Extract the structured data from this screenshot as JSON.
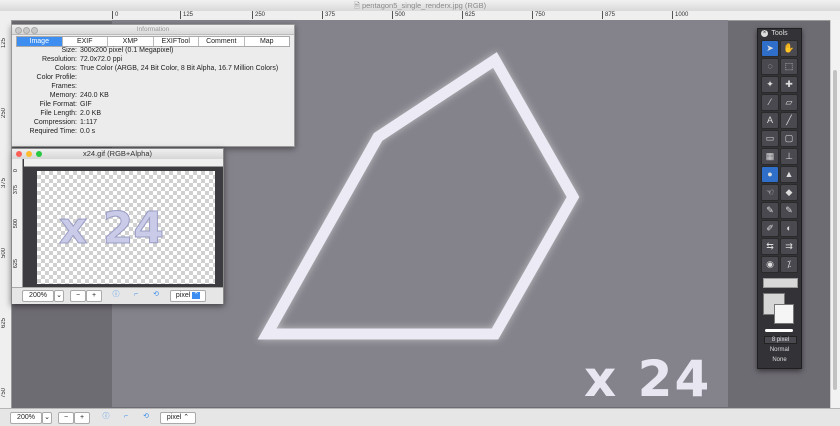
{
  "window": {
    "title": "pentagon5_single_renderx.jpg (RGB)"
  },
  "ruler_top": [
    "0",
    "125",
    "250",
    "375",
    "500",
    "625",
    "750",
    "875",
    "1000"
  ],
  "ruler_left": [
    "125",
    "250",
    "375",
    "500",
    "625",
    "750"
  ],
  "canvas": {
    "overlay_text": "x 24"
  },
  "bottom": {
    "zoom": "200%",
    "minus": "−",
    "plus": "+",
    "unit": "pixel"
  },
  "info": {
    "title": "Information",
    "tabs": [
      "Image",
      "EXIF",
      "XMP",
      "EXIFTool",
      "Comment",
      "Map"
    ],
    "rows": [
      {
        "k": "Size:",
        "v": "300x200 pixel (0.1 Megapixel)"
      },
      {
        "k": "Resolution:",
        "v": "72.0x72.0 ppi"
      },
      {
        "k": "Colors:",
        "v": "True Color (ARGB, 24 Bit Color, 8 Bit Alpha, 16.7 Million Colors)"
      },
      {
        "k": "Color Profile:",
        "v": ""
      },
      {
        "k": "Frames:",
        "v": ""
      },
      {
        "k": "Memory:",
        "v": "240.0 KB"
      },
      {
        "k": "File Format:",
        "v": "GIF"
      },
      {
        "k": "File Length:",
        "v": "2.0 KB"
      },
      {
        "k": "Compression:",
        "v": "1:117"
      },
      {
        "k": "Required Time:",
        "v": "0.0 s"
      }
    ]
  },
  "gif": {
    "title": "x24.gif (RGB+Alpha)",
    "ruler_left": [
      "0",
      "375",
      "500",
      "625"
    ],
    "canvas_text": "x 24",
    "zoom": "200%",
    "unit": "pixel"
  },
  "tools": {
    "title": "Tools",
    "brush_size": "8 pixel",
    "blend": "Normal",
    "mode": "None"
  },
  "colors": {
    "accent": "#3d8ef0",
    "canvas": "#84828a",
    "shape": "#eceaf5"
  }
}
